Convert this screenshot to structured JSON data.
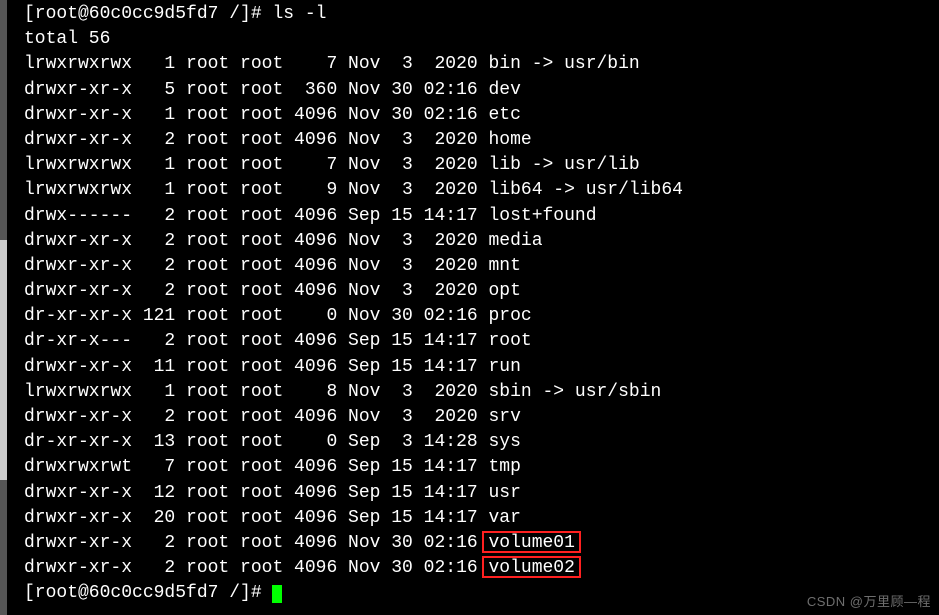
{
  "prompt": "[root@60c0cc9d5fd7 /]# ",
  "command": "ls -l",
  "total_line": "total 56",
  "rows": [
    {
      "perm": "lrwxrwxrwx",
      "links": "1",
      "user": "root",
      "group": "root",
      "size": "7",
      "month": "Nov",
      "day": "3",
      "time": "2020",
      "name": "bin -> usr/bin"
    },
    {
      "perm": "drwxr-xr-x",
      "links": "5",
      "user": "root",
      "group": "root",
      "size": "360",
      "month": "Nov",
      "day": "30",
      "time": "02:16",
      "name": "dev"
    },
    {
      "perm": "drwxr-xr-x",
      "links": "1",
      "user": "root",
      "group": "root",
      "size": "4096",
      "month": "Nov",
      "day": "30",
      "time": "02:16",
      "name": "etc"
    },
    {
      "perm": "drwxr-xr-x",
      "links": "2",
      "user": "root",
      "group": "root",
      "size": "4096",
      "month": "Nov",
      "day": "3",
      "time": "2020",
      "name": "home"
    },
    {
      "perm": "lrwxrwxrwx",
      "links": "1",
      "user": "root",
      "group": "root",
      "size": "7",
      "month": "Nov",
      "day": "3",
      "time": "2020",
      "name": "lib -> usr/lib"
    },
    {
      "perm": "lrwxrwxrwx",
      "links": "1",
      "user": "root",
      "group": "root",
      "size": "9",
      "month": "Nov",
      "day": "3",
      "time": "2020",
      "name": "lib64 -> usr/lib64"
    },
    {
      "perm": "drwx------",
      "links": "2",
      "user": "root",
      "group": "root",
      "size": "4096",
      "month": "Sep",
      "day": "15",
      "time": "14:17",
      "name": "lost+found"
    },
    {
      "perm": "drwxr-xr-x",
      "links": "2",
      "user": "root",
      "group": "root",
      "size": "4096",
      "month": "Nov",
      "day": "3",
      "time": "2020",
      "name": "media"
    },
    {
      "perm": "drwxr-xr-x",
      "links": "2",
      "user": "root",
      "group": "root",
      "size": "4096",
      "month": "Nov",
      "day": "3",
      "time": "2020",
      "name": "mnt"
    },
    {
      "perm": "drwxr-xr-x",
      "links": "2",
      "user": "root",
      "group": "root",
      "size": "4096",
      "month": "Nov",
      "day": "3",
      "time": "2020",
      "name": "opt"
    },
    {
      "perm": "dr-xr-xr-x",
      "links": "121",
      "user": "root",
      "group": "root",
      "size": "0",
      "month": "Nov",
      "day": "30",
      "time": "02:16",
      "name": "proc"
    },
    {
      "perm": "dr-xr-x---",
      "links": "2",
      "user": "root",
      "group": "root",
      "size": "4096",
      "month": "Sep",
      "day": "15",
      "time": "14:17",
      "name": "root"
    },
    {
      "perm": "drwxr-xr-x",
      "links": "11",
      "user": "root",
      "group": "root",
      "size": "4096",
      "month": "Sep",
      "day": "15",
      "time": "14:17",
      "name": "run"
    },
    {
      "perm": "lrwxrwxrwx",
      "links": "1",
      "user": "root",
      "group": "root",
      "size": "8",
      "month": "Nov",
      "day": "3",
      "time": "2020",
      "name": "sbin -> usr/sbin"
    },
    {
      "perm": "drwxr-xr-x",
      "links": "2",
      "user": "root",
      "group": "root",
      "size": "4096",
      "month": "Nov",
      "day": "3",
      "time": "2020",
      "name": "srv"
    },
    {
      "perm": "dr-xr-xr-x",
      "links": "13",
      "user": "root",
      "group": "root",
      "size": "0",
      "month": "Sep",
      "day": "3",
      "time": "14:28",
      "name": "sys"
    },
    {
      "perm": "drwxrwxrwt",
      "links": "7",
      "user": "root",
      "group": "root",
      "size": "4096",
      "month": "Sep",
      "day": "15",
      "time": "14:17",
      "name": "tmp"
    },
    {
      "perm": "drwxr-xr-x",
      "links": "12",
      "user": "root",
      "group": "root",
      "size": "4096",
      "month": "Sep",
      "day": "15",
      "time": "14:17",
      "name": "usr"
    },
    {
      "perm": "drwxr-xr-x",
      "links": "20",
      "user": "root",
      "group": "root",
      "size": "4096",
      "month": "Sep",
      "day": "15",
      "time": "14:17",
      "name": "var"
    },
    {
      "perm": "drwxr-xr-x",
      "links": "2",
      "user": "root",
      "group": "root",
      "size": "4096",
      "month": "Nov",
      "day": "30",
      "time": "02:16",
      "name": "volume01",
      "highlight": true
    },
    {
      "perm": "drwxr-xr-x",
      "links": "2",
      "user": "root",
      "group": "root",
      "size": "4096",
      "month": "Nov",
      "day": "30",
      "time": "02:16",
      "name": "volume02",
      "highlight": true
    }
  ],
  "bottom_prompt": "[root@60c0cc9d5fd7 /]# ",
  "watermark": "CSDN @万里顾—程"
}
